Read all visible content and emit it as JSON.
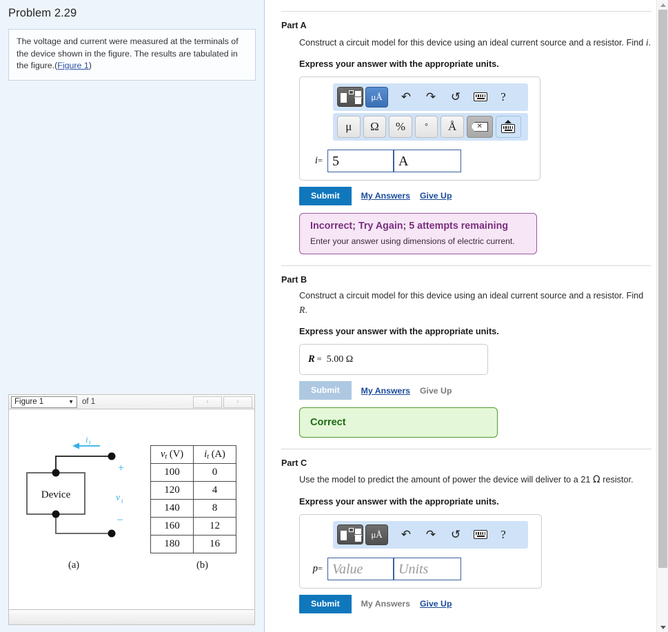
{
  "left": {
    "problem_title": "Problem 2.29",
    "prompt_text": "The voltage and current were measured at the terminals of the device shown in the figure. The results are tabulated in the figure.",
    "prompt_link_open": "(",
    "prompt_link": "Figure 1",
    "prompt_link_close": ")",
    "figure_bar": {
      "selected": "Figure 1",
      "caret": "▼",
      "of_label": "of 1",
      "prev": "‹",
      "next": "›"
    },
    "figure": {
      "device_label": "Device",
      "current_label": "i",
      "current_sub": "t",
      "voltage_label": "v",
      "voltage_sub": "t",
      "plus": "+",
      "minus": "–",
      "caption_a": "(a)",
      "caption_b": "(b)"
    }
  },
  "chart_data": {
    "type": "table",
    "title": "",
    "columns": [
      "v_t (V)",
      "i_t (A)"
    ],
    "column_headers_rich": [
      {
        "var": "v",
        "sub": "t",
        "unit": "(V)"
      },
      {
        "var": "i",
        "sub": "t",
        "unit": "(A)"
      }
    ],
    "rows": [
      [
        "100",
        "0"
      ],
      [
        "120",
        "4"
      ],
      [
        "140",
        "8"
      ],
      [
        "160",
        "12"
      ],
      [
        "180",
        "16"
      ]
    ],
    "xlabel": "v_t (V)",
    "ylabel": "i_t (A)",
    "grid": true
  },
  "toolbar": {
    "template_icon": "math-template-icon",
    "units_label": "μÅ",
    "undo_icon": "↶",
    "redo_icon": "↷",
    "reset_icon": "↺",
    "keyboard_icon": "keyboard-icon",
    "help_icon": "?",
    "keys": [
      "μ",
      "Ω",
      "%",
      "°",
      "Å"
    ],
    "backspace_icon": "⌫",
    "hide_keyboard_icon": "hide-keyboard-icon"
  },
  "partA": {
    "heading": "Part A",
    "question": "Construct a circuit model for this device using an ideal current source and a resistor. Find",
    "question_var": "i",
    "question_end": ".",
    "instruction": "Express your answer with the appropriate units.",
    "var_label": "i",
    "equals": "=",
    "value": "5",
    "units": "A",
    "submit_label": "Submit",
    "my_answers_label": "My Answers",
    "give_up_label": "Give Up",
    "feedback_title": "Incorrect; Try Again; 5 attempts remaining",
    "feedback_detail": "Enter your answer using dimensions of electric current.",
    "feedback_color": "#7a2f7f"
  },
  "partB": {
    "heading": "Part B",
    "question": "Construct a circuit model for this device using an ideal current source and a resistor. Find",
    "question_var": "R",
    "question_end": ".",
    "instruction": "Express your answer with the appropriate units.",
    "var_label": "R",
    "equals": "=",
    "answer_value": "5.00 Ω",
    "submit_label": "Submit",
    "my_answers_label": "My Answers",
    "give_up_label": "Give Up",
    "feedback_title": "Correct",
    "feedback_color": "#1c6b14"
  },
  "partC": {
    "heading": "Part C",
    "question_pre": "Use the model to predict the amount of power the device will deliver to a 21",
    "question_omega": "Ω",
    "question_post": "resistor.",
    "instruction": "Express your answer with the appropriate units.",
    "var_label": "p",
    "equals": "=",
    "value_placeholder": "Value",
    "units_placeholder": "Units",
    "submit_label": "Submit",
    "my_answers_label": "My Answers",
    "give_up_label": "Give Up"
  },
  "scrollbar": {
    "up_icon": "scroll-up-icon",
    "down_icon": "scroll-down-icon"
  },
  "colors": {
    "accent": "#1077bd",
    "link": "#1a4b9b",
    "toolbar_bg": "#cfe2f7",
    "incorrect_bg": "#f6e6f6",
    "incorrect_border": "#9b57a0",
    "correct_bg": "#e4f7d8",
    "correct_border": "#4e9b2f",
    "figure_cyan": "#31b0e8",
    "left_bg": "#eef4fb"
  }
}
